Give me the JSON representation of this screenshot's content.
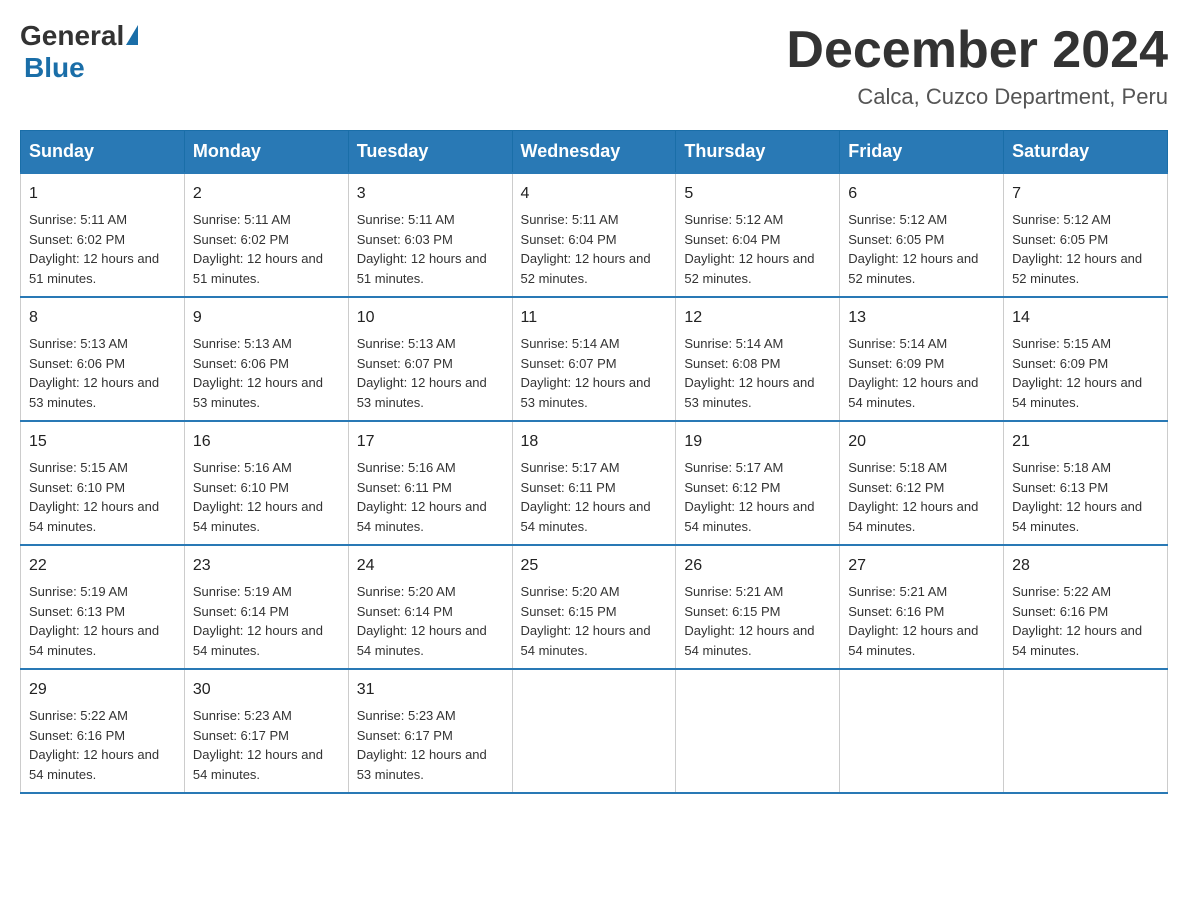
{
  "header": {
    "logo_general": "General",
    "logo_blue": "Blue",
    "month_title": "December 2024",
    "location": "Calca, Cuzco Department, Peru"
  },
  "days_of_week": [
    "Sunday",
    "Monday",
    "Tuesday",
    "Wednesday",
    "Thursday",
    "Friday",
    "Saturday"
  ],
  "weeks": [
    [
      {
        "day": "1",
        "sunrise": "5:11 AM",
        "sunset": "6:02 PM",
        "daylight": "12 hours and 51 minutes."
      },
      {
        "day": "2",
        "sunrise": "5:11 AM",
        "sunset": "6:02 PM",
        "daylight": "12 hours and 51 minutes."
      },
      {
        "day": "3",
        "sunrise": "5:11 AM",
        "sunset": "6:03 PM",
        "daylight": "12 hours and 51 minutes."
      },
      {
        "day": "4",
        "sunrise": "5:11 AM",
        "sunset": "6:04 PM",
        "daylight": "12 hours and 52 minutes."
      },
      {
        "day": "5",
        "sunrise": "5:12 AM",
        "sunset": "6:04 PM",
        "daylight": "12 hours and 52 minutes."
      },
      {
        "day": "6",
        "sunrise": "5:12 AM",
        "sunset": "6:05 PM",
        "daylight": "12 hours and 52 minutes."
      },
      {
        "day": "7",
        "sunrise": "5:12 AM",
        "sunset": "6:05 PM",
        "daylight": "12 hours and 52 minutes."
      }
    ],
    [
      {
        "day": "8",
        "sunrise": "5:13 AM",
        "sunset": "6:06 PM",
        "daylight": "12 hours and 53 minutes."
      },
      {
        "day": "9",
        "sunrise": "5:13 AM",
        "sunset": "6:06 PM",
        "daylight": "12 hours and 53 minutes."
      },
      {
        "day": "10",
        "sunrise": "5:13 AM",
        "sunset": "6:07 PM",
        "daylight": "12 hours and 53 minutes."
      },
      {
        "day": "11",
        "sunrise": "5:14 AM",
        "sunset": "6:07 PM",
        "daylight": "12 hours and 53 minutes."
      },
      {
        "day": "12",
        "sunrise": "5:14 AM",
        "sunset": "6:08 PM",
        "daylight": "12 hours and 53 minutes."
      },
      {
        "day": "13",
        "sunrise": "5:14 AM",
        "sunset": "6:09 PM",
        "daylight": "12 hours and 54 minutes."
      },
      {
        "day": "14",
        "sunrise": "5:15 AM",
        "sunset": "6:09 PM",
        "daylight": "12 hours and 54 minutes."
      }
    ],
    [
      {
        "day": "15",
        "sunrise": "5:15 AM",
        "sunset": "6:10 PM",
        "daylight": "12 hours and 54 minutes."
      },
      {
        "day": "16",
        "sunrise": "5:16 AM",
        "sunset": "6:10 PM",
        "daylight": "12 hours and 54 minutes."
      },
      {
        "day": "17",
        "sunrise": "5:16 AM",
        "sunset": "6:11 PM",
        "daylight": "12 hours and 54 minutes."
      },
      {
        "day": "18",
        "sunrise": "5:17 AM",
        "sunset": "6:11 PM",
        "daylight": "12 hours and 54 minutes."
      },
      {
        "day": "19",
        "sunrise": "5:17 AM",
        "sunset": "6:12 PM",
        "daylight": "12 hours and 54 minutes."
      },
      {
        "day": "20",
        "sunrise": "5:18 AM",
        "sunset": "6:12 PM",
        "daylight": "12 hours and 54 minutes."
      },
      {
        "day": "21",
        "sunrise": "5:18 AM",
        "sunset": "6:13 PM",
        "daylight": "12 hours and 54 minutes."
      }
    ],
    [
      {
        "day": "22",
        "sunrise": "5:19 AM",
        "sunset": "6:13 PM",
        "daylight": "12 hours and 54 minutes."
      },
      {
        "day": "23",
        "sunrise": "5:19 AM",
        "sunset": "6:14 PM",
        "daylight": "12 hours and 54 minutes."
      },
      {
        "day": "24",
        "sunrise": "5:20 AM",
        "sunset": "6:14 PM",
        "daylight": "12 hours and 54 minutes."
      },
      {
        "day": "25",
        "sunrise": "5:20 AM",
        "sunset": "6:15 PM",
        "daylight": "12 hours and 54 minutes."
      },
      {
        "day": "26",
        "sunrise": "5:21 AM",
        "sunset": "6:15 PM",
        "daylight": "12 hours and 54 minutes."
      },
      {
        "day": "27",
        "sunrise": "5:21 AM",
        "sunset": "6:16 PM",
        "daylight": "12 hours and 54 minutes."
      },
      {
        "day": "28",
        "sunrise": "5:22 AM",
        "sunset": "6:16 PM",
        "daylight": "12 hours and 54 minutes."
      }
    ],
    [
      {
        "day": "29",
        "sunrise": "5:22 AM",
        "sunset": "6:16 PM",
        "daylight": "12 hours and 54 minutes."
      },
      {
        "day": "30",
        "sunrise": "5:23 AM",
        "sunset": "6:17 PM",
        "daylight": "12 hours and 54 minutes."
      },
      {
        "day": "31",
        "sunrise": "5:23 AM",
        "sunset": "6:17 PM",
        "daylight": "12 hours and 53 minutes."
      },
      null,
      null,
      null,
      null
    ]
  ]
}
